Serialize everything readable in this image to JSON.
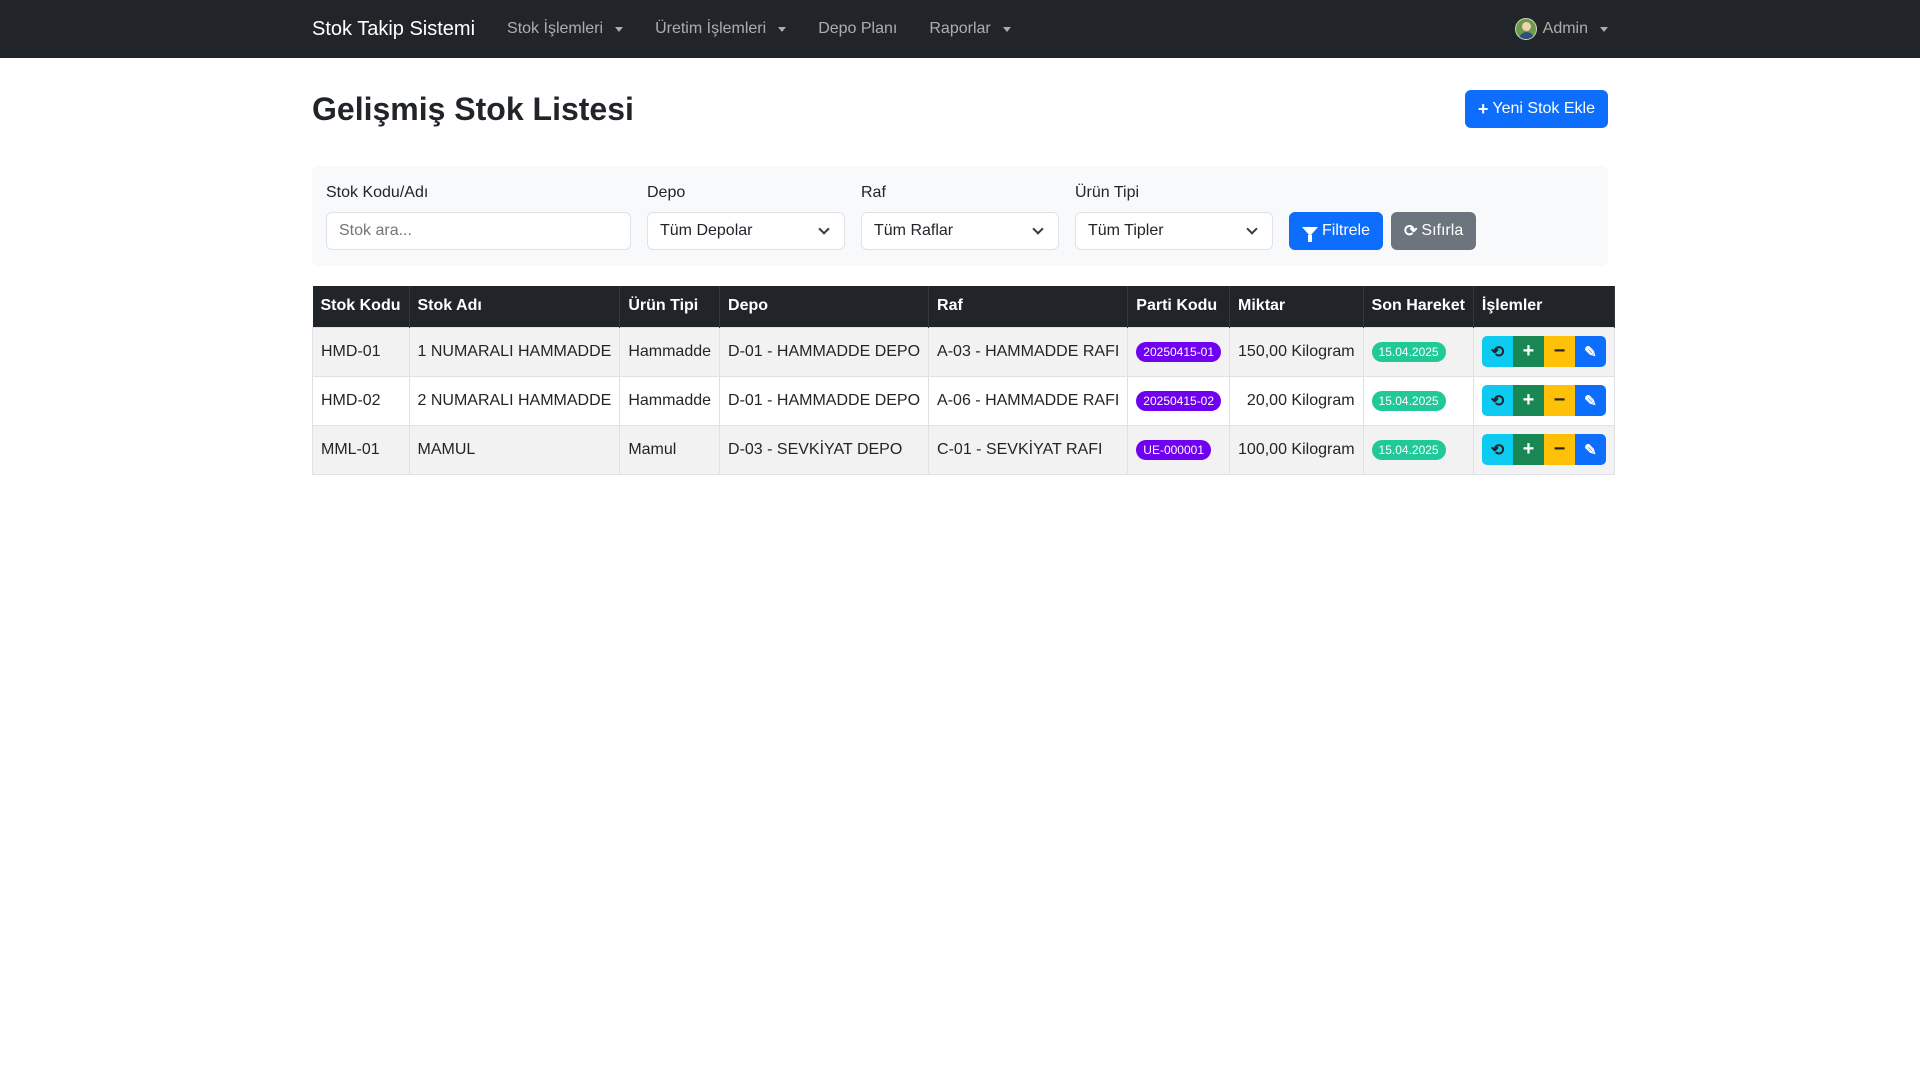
{
  "navbar": {
    "brand": "Stok Takip Sistemi",
    "items": [
      {
        "label": "Stok İşlemleri",
        "dropdown": true
      },
      {
        "label": "Üretim İşlemleri",
        "dropdown": true
      },
      {
        "label": "Depo Planı",
        "dropdown": false
      },
      {
        "label": "Raporlar",
        "dropdown": true
      }
    ],
    "user": "Admin"
  },
  "page": {
    "title": "Gelişmiş Stok Listesi",
    "add_button": "Yeni Stok Ekle"
  },
  "filters": {
    "stock_label": "Stok Kodu/Adı",
    "stock_placeholder": "Stok ara...",
    "depot_label": "Depo",
    "depot_value": "Tüm Depolar",
    "shelf_label": "Raf",
    "shelf_value": "Tüm Raflar",
    "type_label": "Ürün Tipi",
    "type_value": "Tüm Tipler",
    "filter_button": "Filtrele",
    "reset_button": "Sıfırla"
  },
  "table": {
    "headers": [
      "Stok Kodu",
      "Stok Adı",
      "Ürün Tipi",
      "Depo",
      "Raf",
      "Parti Kodu",
      "Miktar",
      "Son Hareket",
      "İşlemler"
    ],
    "rows": [
      {
        "code": "HMD-01",
        "name": "1 NUMARALI HAMMADDE",
        "type": "Hammadde",
        "depot": "D-01 - HAMMADDE DEPO",
        "shelf": "A-03 - HAMMADDE RAFI",
        "batch": "20250415-01",
        "qty": "150,00 Kilogram",
        "last": "15.04.2025"
      },
      {
        "code": "HMD-02",
        "name": "2 NUMARALI HAMMADDE",
        "type": "Hammadde",
        "depot": "D-01 - HAMMADDE DEPO",
        "shelf": "A-06 - HAMMADDE RAFI",
        "batch": "20250415-02",
        "qty": "20,00 Kilogram",
        "last": "15.04.2025"
      },
      {
        "code": "MML-01",
        "name": "MAMUL",
        "type": "Mamul",
        "depot": "D-03 - SEVKİYAT DEPO",
        "shelf": "C-01 - SEVKİYAT RAFI",
        "batch": "UE-000001",
        "qty": "100,00 Kilogram",
        "last": "15.04.2025"
      }
    ]
  },
  "icons": {
    "history": "history-icon",
    "plus": "plus-icon",
    "minus": "minus-icon",
    "edit": "edit-icon"
  },
  "colors": {
    "navbar": "#212529",
    "primary": "#0d6efd",
    "secondary": "#6c757d",
    "info": "#0dcaf0",
    "success": "#198754",
    "warning": "#ffc107",
    "batch_badge": "#6f00f0",
    "date_badge": "#20c997"
  }
}
